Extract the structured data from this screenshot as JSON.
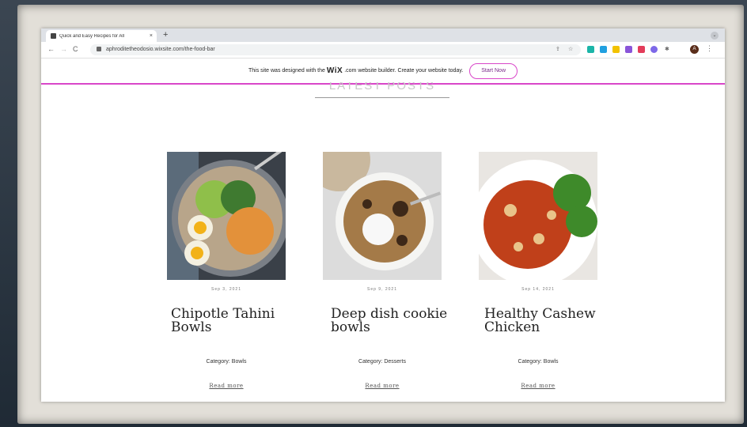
{
  "browser": {
    "tab_title": "Quick and Easy Recipes for All",
    "tab_close": "×",
    "new_tab": "+",
    "url": "aphroditetheodosio.wixsite.com/the-food-bar",
    "avatar_letter": "A"
  },
  "banner": {
    "text_before": "This site was designed with the",
    "brand": "WiX",
    "text_after": ".com website builder. Create your website today.",
    "cta": "Start Now"
  },
  "section_title": "LATEST POSTS",
  "posts": [
    {
      "date": "Sep 3, 2021",
      "title": "Chipotle Tahini Bowls",
      "category": "Category: Bowls",
      "read_more": "Read more"
    },
    {
      "date": "Sep 9, 2021",
      "title": "Deep dish cookie bowls",
      "category": "Category: Desserts",
      "read_more": "Read more"
    },
    {
      "date": "Sep 14, 2021",
      "title": "Healthy Cashew Chicken",
      "category": "Category: Bowls",
      "read_more": "Read more"
    }
  ],
  "colors": {
    "accent": "#d946c9",
    "background": "#ffffff",
    "frame": "#e2dfd8"
  }
}
